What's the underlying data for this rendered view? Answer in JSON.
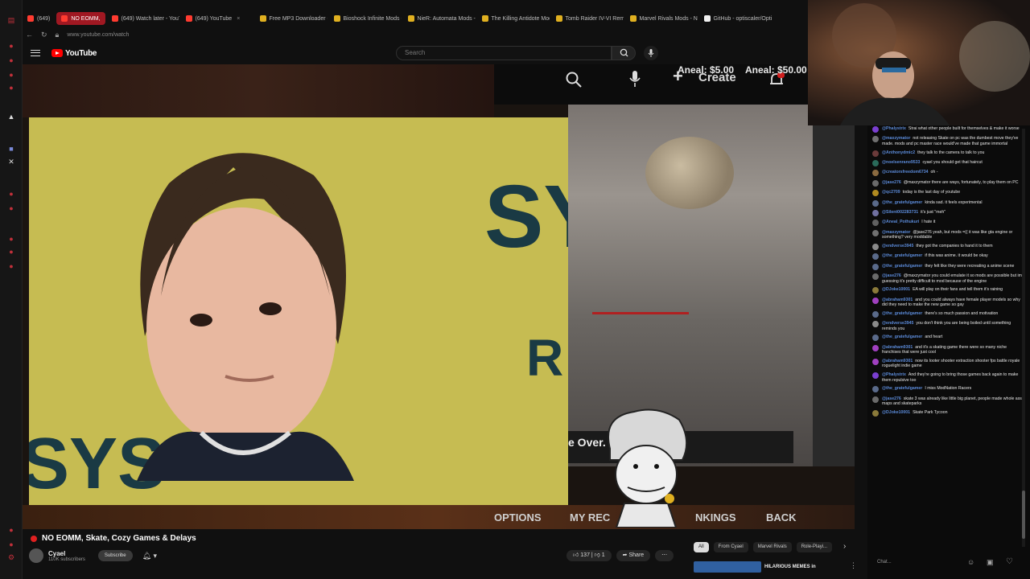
{
  "browser": {
    "tabs": [
      {
        "label": "(649)",
        "color": "#ff3b30",
        "active": false
      },
      {
        "label": "NO EOMM,",
        "color": "#ff3b30",
        "active": true
      },
      {
        "label": "(649) Watch later - YouT...",
        "color": "#ff3b30",
        "active": false
      },
      {
        "label": "(649) YouTube",
        "color": "#ff3b30",
        "active": false
      },
      {
        "label": "Free MP3 Downloader - ...",
        "color": "#e0b020",
        "active": false
      },
      {
        "label": "Bioshock Infinite Mods - ...",
        "color": "#e0b020",
        "active": false
      },
      {
        "label": "NieR: Automata Mods - ...",
        "color": "#e0b020",
        "active": false
      },
      {
        "label": "The Killing Antidote Mods ...",
        "color": "#e0b020",
        "active": false
      },
      {
        "label": "Tomb Raider IV-VI Remas...",
        "color": "#e0b020",
        "active": false
      },
      {
        "label": "Marvel Rivals Mods - Nex...",
        "color": "#e0b020",
        "active": false
      },
      {
        "label": "GitHub - optiscaler/Opti...",
        "color": "#f0f0f0",
        "active": false
      }
    ],
    "url": "www.youtube.com/watch"
  },
  "youtube": {
    "logo_text": "YouTube",
    "search_placeholder": "Search"
  },
  "video_overlay": {
    "create_label": "Create",
    "donation_1": "Aneal: $5.00",
    "donation_2": "Aneal: $50.00",
    "photo_text_1": "SY",
    "photo_text_2": "R",
    "photo_text_3": "SYS",
    "game_text": "e Over.",
    "menu_options": "OPTIONS",
    "menu_records": "MY REC",
    "menu_rankings": "NKINGS",
    "menu_back": "BACK"
  },
  "video": {
    "title": "NO EOMM, Skate, Cozy Games & Delays",
    "channel": "Cyael",
    "subscribers": "110K subscribers",
    "subscribe_label": "Subscribe",
    "likes": "137",
    "dislikes": "1",
    "share_label": "Share"
  },
  "chips": [
    "All",
    "From Cyael",
    "Marvel Rivals",
    "Role-Playi..."
  ],
  "recommended": {
    "title": "HILARIOUS MEMES in"
  },
  "chat": {
    "input_placeholder": "Chat...",
    "messages": [
      {
        "user": "@Phalystrix",
        "text": "Strai what other people built for themselves & make it worse",
        "color": "#7a3fd0"
      },
      {
        "user": "@maxzymator",
        "text": "not releasing Skate on pc was the dumbest move they've made. mods and pc master race would've made that game immortal",
        "color": "#707070"
      },
      {
        "user": "@Anthonydmic2",
        "text": "they talk to the camera to talk to you",
        "color": "#6a3a3a"
      },
      {
        "user": "@noelsenrano9533",
        "text": "cyael you should get that haircut",
        "color": "#2a6a5a"
      },
      {
        "user": "@creatorsfreedom6734",
        "text": "oh -",
        "color": "#8a6a40"
      },
      {
        "user": "@jase276",
        "text": "@maxzymator there are ways, fortunately, to play them on PC",
        "color": "#6a6a6a"
      },
      {
        "user": "@qc2709",
        "text": "today is the last day of youtube",
        "color": "#b08a20"
      },
      {
        "user": "@the_gratefulgamer",
        "text": "kinda sad. it feels experimental",
        "color": "#5a6a8a"
      },
      {
        "user": "@Silent002283731",
        "text": "it's just \"meh\"",
        "color": "#7070a0"
      },
      {
        "user": "@Aneal_Pothukuri",
        "text": "I hate it",
        "color": "#606060"
      },
      {
        "user": "@maxzymator",
        "text": "@jase276 yeah, but mods =(( it was like gta engine or something? very moddable",
        "color": "#707070"
      },
      {
        "user": "@endverse3945",
        "text": "they got the companies to hand it to them",
        "color": "#8a8a8a"
      },
      {
        "user": "@the_gratefulgamer",
        "text": "if this was anime. it would be okay",
        "color": "#5a6a8a"
      },
      {
        "user": "@the_gratefulgamer",
        "text": "they felt like they were recreating a anime scene",
        "color": "#5a6a8a"
      },
      {
        "user": "@jase276",
        "text": "@maxzymator you could emulate it so mods are possible but im guessing it's pretty difficult to mod because of the engine",
        "color": "#6a6a6a"
      },
      {
        "user": "@DJoke10001",
        "text": "EA will play on their fans and tell them it's raining",
        "color": "#8a7a3a"
      },
      {
        "user": "@abraham9301",
        "text": "and you could always have female player models so why did they need to make the new game so gay",
        "color": "#a040c0"
      },
      {
        "user": "@the_gratefulgamer",
        "text": "there's so much passion and motivation",
        "color": "#5a6a8a"
      },
      {
        "user": "@endverse3945",
        "text": "you don't think you are being boiled until something reminds you",
        "color": "#8a8a8a"
      },
      {
        "user": "@the_gratefulgamer",
        "text": "and heart",
        "color": "#5a6a8a"
      },
      {
        "user": "@abraham9301",
        "text": "and it's a skating game there were so many niche franchises that were just cool",
        "color": "#a040c0"
      },
      {
        "user": "@abraham9301",
        "text": "now its looter shooter extraction shooter fps battle royale roguelight indie game",
        "color": "#a040c0"
      },
      {
        "user": "@Phalystrix",
        "text": "And they're going to bring those games back again to make them repulsive too",
        "color": "#7a3fd0"
      },
      {
        "user": "@the_gratefulgamer",
        "text": "I miss ModNation Racers",
        "color": "#5a6a8a"
      },
      {
        "user": "@jase276",
        "text": "skate 3 was already like little big planet, people made whole ass maps and skateparks",
        "color": "#6a6a6a"
      },
      {
        "user": "@DJoke10001",
        "text": "Skate Park Tycoon",
        "color": "#8a7a3a"
      }
    ]
  }
}
